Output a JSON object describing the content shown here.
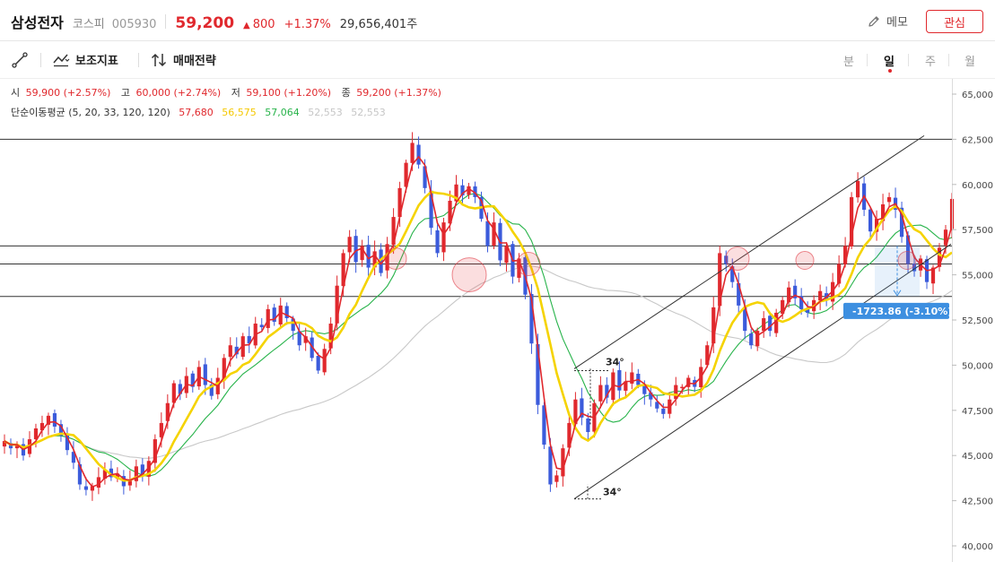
{
  "header": {
    "stock_name": "삼성전자",
    "market": "코스피",
    "code": "005930",
    "price": "59,200",
    "change_arrow": "▲",
    "change": "800",
    "change_pct": "+1.37%",
    "volume": "29,656,401주",
    "memo_label": "메모",
    "favorite_label": "관심"
  },
  "toolbar": {
    "indicator_label": "보조지표",
    "strategy_label": "매매전략",
    "periods": [
      "분",
      "일",
      "주",
      "월"
    ],
    "active_period": "일"
  },
  "legend": {
    "ohlc": [
      {
        "key": "시",
        "value": "59,900 (+2.57%)"
      },
      {
        "key": "고",
        "value": "60,000 (+2.74%)"
      },
      {
        "key": "저",
        "value": "59,100 (+1.20%)"
      },
      {
        "key": "종",
        "value": "59,200 (+1.37%)"
      }
    ],
    "ma_title": "단순이동평균 (5, 20, 33, 120, 120)",
    "ma_values": [
      {
        "value": "57,680",
        "color": "#e0282d"
      },
      {
        "value": "56,575",
        "color": "#f5c800"
      },
      {
        "value": "57,064",
        "color": "#27b34a"
      },
      {
        "value": "52,553",
        "color": "#c6c6c6"
      },
      {
        "value": "52,553",
        "color": "#c6c6c6"
      }
    ]
  },
  "chart_data": {
    "type": "candlestick",
    "y_range": [
      40000,
      65000
    ],
    "y_ticks": [
      "65,000",
      "62,500",
      "60,000",
      "57,500",
      "55,000",
      "52,500",
      "50,000",
      "47,500",
      "45,000",
      "42,500",
      "40,000"
    ],
    "y_tick_values": [
      65000,
      62500,
      60000,
      57500,
      55000,
      52500,
      50000,
      47500,
      45000,
      42500,
      40000
    ],
    "colors": {
      "up": "#e0282d",
      "down": "#3b5bdb",
      "ma5": "#e0282d",
      "ma20": "#f5d300",
      "ma33": "#27b34a",
      "ma120": "#c8c8c8"
    },
    "horizontal_lines": [
      62500,
      56600,
      55600,
      53800
    ],
    "channel_annotation": "34°",
    "channel_annotation_2": "34°",
    "measure_label": "-1723.86 (-3.10%)",
    "close_series": [
      45800,
      45400,
      45600,
      45000,
      45900,
      46500,
      46800,
      47200,
      46600,
      46100,
      45300,
      44600,
      43400,
      43100,
      43300,
      43800,
      44200,
      43800,
      44000,
      43300,
      43600,
      44400,
      43900,
      44700,
      45900,
      46800,
      47900,
      49000,
      48400,
      49400,
      48800,
      49900,
      48900,
      48300,
      49300,
      50400,
      51100,
      50600,
      51600,
      51200,
      52300,
      52100,
      53100,
      52400,
      53300,
      52600,
      51900,
      51100,
      51600,
      50400,
      49700,
      50900,
      52300,
      54400,
      56200,
      57100,
      55700,
      56600,
      55400,
      56300,
      55100,
      56700,
      58200,
      59800,
      61200,
      62300,
      61100,
      59800,
      57600,
      56200,
      57900,
      59100,
      60000,
      59400,
      59900,
      59300,
      58100,
      56600,
      57900,
      55800,
      56600,
      54900,
      55900,
      53900,
      51200,
      47800,
      45600,
      43400,
      43900,
      45400,
      46800,
      48100,
      47100,
      46300,
      47900,
      48900,
      48200,
      49600,
      48600,
      49100,
      49600,
      48900,
      48400,
      48100,
      47600,
      47300,
      48100,
      48900,
      48800,
      49300,
      48800,
      49900,
      51100,
      53200,
      56200,
      55600,
      54600,
      53300,
      51900,
      51100,
      51900,
      52600,
      51900,
      52900,
      53600,
      54300,
      53700,
      53100,
      52900,
      53600,
      54100,
      53600,
      54600,
      55600,
      56600,
      59300,
      60200,
      58600,
      57400,
      58100,
      58900,
      59300,
      58600,
      57100,
      55600,
      55200,
      55900,
      54600,
      55400,
      56500,
      57500,
      59200
    ]
  }
}
